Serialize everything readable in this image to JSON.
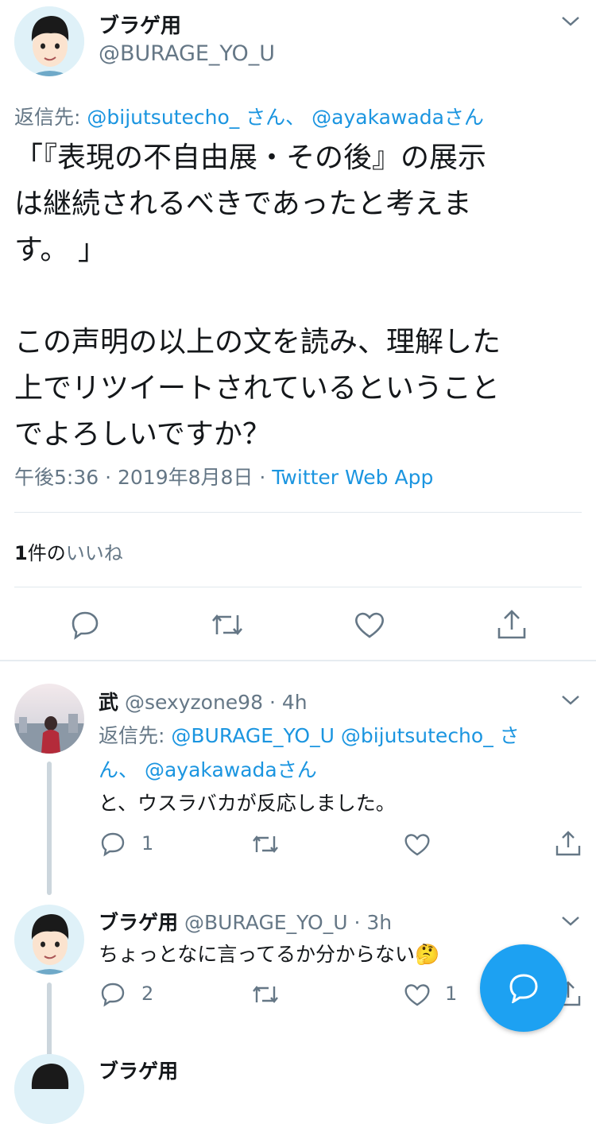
{
  "main_tweet": {
    "name": "ブラゲ用",
    "handle": "@BURAGE_YO_U",
    "reply_prefix": "返信先:",
    "reply_to_1": "@bijutsutecho_ さん、",
    "reply_to_2": "@ayakawada",
    "reply_suffix": "さん",
    "text_lines": [
      "「『表現の不自由展・その後』の展示",
      "は継続されるべきであったと考えま",
      "す。 」",
      "",
      "この声明の以上の文を読み、理解した",
      "上でリツイートされているということ",
      "でよろしいですか？"
    ],
    "time": "午後5:36",
    "date": "2019年8月8日",
    "source": "Twitter Web App",
    "likes_count": "1",
    "likes_unit": "件の",
    "likes_label": "いいね"
  },
  "reply1": {
    "name": "武",
    "handle": "@sexyzone98",
    "time": "4h",
    "reply_prefix": "返信先:",
    "reply_to_1": "@BURAGE_YO_U @bijutsutecho_ さ",
    "reply_to_2": "ん、",
    "reply_to_3": "@ayakawada",
    "reply_suffix": "さん",
    "text": "と、ウスラバカが反応しました。",
    "reply_count": "1",
    "retweet_count": "",
    "like_count": ""
  },
  "reply2": {
    "name": "ブラゲ用",
    "handle": "@BURAGE_YO_U",
    "time": "3h",
    "text": "ちょっとなに言ってるか分からない🤔",
    "reply_count": "2",
    "retweet_count": "",
    "like_count": "1"
  },
  "reply3": {
    "name": "ブラゲ用"
  },
  "separator": "·",
  "colors": {
    "accent": "#1da1f2",
    "link": "#1b95e0",
    "secondary": "#657786",
    "divider": "#e1e8ed"
  }
}
